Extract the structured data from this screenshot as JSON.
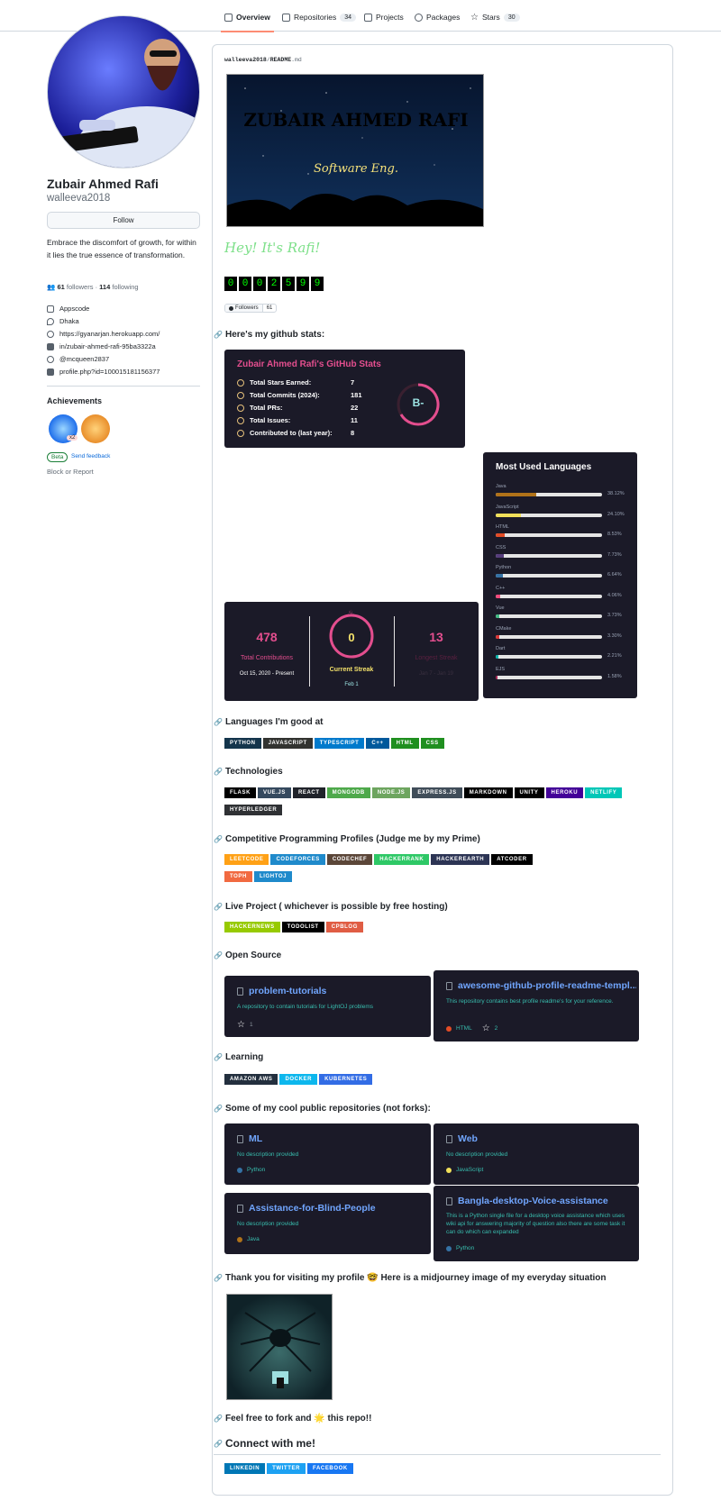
{
  "nav": {
    "tabs": [
      {
        "label": "Overview"
      },
      {
        "label": "Repositories",
        "count": "34"
      },
      {
        "label": "Projects"
      },
      {
        "label": "Packages"
      },
      {
        "label": "Stars",
        "count": "30"
      }
    ]
  },
  "profile": {
    "name": "Zubair Ahmed Rafi",
    "login": "walleeva2018",
    "follow_label": "Follow",
    "bio": "Embrace the discomfort of growth, for within it lies the true essence of transformation.",
    "followers": "61",
    "followers_label": "followers",
    "sep": "·",
    "following": "114",
    "following_label": "following",
    "company": "Appscode",
    "location": "Dhaka",
    "website": "https://gyanarjan.herokuapp.com/",
    "linkedin": "in/zubair-ahmed-rafi-95ba3322a",
    "twitter": "@mcqueen2837",
    "facebook": "profile.php?id=100015181156377",
    "achievements_title": "Achievements",
    "ach_count": "x2",
    "beta": "Beta",
    "feedback": "Send feedback",
    "block": "Block or Report"
  },
  "readme": {
    "path_user": "walleeva2018",
    "path_sep": "/",
    "path_file": "README",
    "path_ext": ".md",
    "banner_title": "ZUBAIR AHMED RAFI",
    "banner_sub": "Software Eng.",
    "greeting": "Hey! It's Rafi!",
    "counter": [
      "0",
      "0",
      "0",
      "2",
      "5",
      "9",
      "9"
    ],
    "followers_badge_label": "Followers",
    "followers_badge_count": "61",
    "h_stats": "Here's my github stats:",
    "stats_card": {
      "title": "Zubair Ahmed Rafi's GitHub Stats",
      "grade": "B-",
      "rows": [
        {
          "label": "Total Stars Earned:",
          "value": "7"
        },
        {
          "label": "Total Commits (2024):",
          "value": "181"
        },
        {
          "label": "Total PRs:",
          "value": "22"
        },
        {
          "label": "Total Issues:",
          "value": "11"
        },
        {
          "label": "Contributed to (last year):",
          "value": "8"
        }
      ]
    },
    "langs_card": {
      "title": "Most Used Languages",
      "langs": [
        {
          "name": "Java",
          "pct": "38.12%",
          "value": 38.12,
          "color": "#b07219"
        },
        {
          "name": "JavaScript",
          "pct": "24.10%",
          "value": 24.1,
          "color": "#f1e05a"
        },
        {
          "name": "HTML",
          "pct": "8.53%",
          "value": 8.53,
          "color": "#e34c26"
        },
        {
          "name": "CSS",
          "pct": "7.73%",
          "value": 7.73,
          "color": "#563d7c"
        },
        {
          "name": "Python",
          "pct": "6.64%",
          "value": 6.64,
          "color": "#3572A5"
        },
        {
          "name": "C++",
          "pct": "4.06%",
          "value": 4.06,
          "color": "#f34b7d"
        },
        {
          "name": "Vue",
          "pct": "3.73%",
          "value": 3.73,
          "color": "#41b883"
        },
        {
          "name": "CMake",
          "pct": "3.30%",
          "value": 3.3,
          "color": "#DA3434"
        },
        {
          "name": "Dart",
          "pct": "2.21%",
          "value": 2.21,
          "color": "#00B4AB"
        },
        {
          "name": "EJS",
          "pct": "1.58%",
          "value": 1.58,
          "color": "#a91e50"
        }
      ]
    },
    "streak": {
      "total": "478",
      "total_label": "Total Contributions",
      "total_range": "Oct 15, 2020 - Present",
      "current": "0",
      "current_label": "Current Streak",
      "current_date": "Feb 1",
      "longest": "13",
      "longest_label": "Longest Streak",
      "longest_range": "Jan 7 - Jan 19"
    },
    "h_langs": "Languages I'm good at",
    "langs": [
      {
        "label": "PYTHON",
        "color": "#14354c"
      },
      {
        "label": "JAVASCRIPT",
        "color": "#323330"
      },
      {
        "label": "TYPESCRIPT",
        "color": "#007acc"
      },
      {
        "label": "C++",
        "color": "#00599c"
      },
      {
        "label": "HTML",
        "color": "#1f8f1f"
      },
      {
        "label": "CSS",
        "color": "#1f8f1f"
      }
    ],
    "h_tech": "Technologies",
    "tech": [
      {
        "label": "FLASK",
        "color": "#000000"
      },
      {
        "label": "VUE.JS",
        "color": "#35495e"
      },
      {
        "label": "REACT",
        "color": "#20232a"
      },
      {
        "label": "MONGODB",
        "color": "#4ea94b"
      },
      {
        "label": "NODE.JS",
        "color": "#6da55f"
      },
      {
        "label": "EXPRESS.JS",
        "color": "#404d59"
      },
      {
        "label": "MARKDOWN",
        "color": "#000000"
      },
      {
        "label": "UNITY",
        "color": "#000000"
      },
      {
        "label": "HEROKU",
        "color": "#430098"
      },
      {
        "label": "NETLIFY",
        "color": "#00c7b7"
      },
      {
        "label": "HYPERLEDGER",
        "color": "#2f3134"
      }
    ],
    "h_cp": "Competitive Programming Profiles (Judge me by my Prime)",
    "cp": [
      {
        "label": "LEETCODE",
        "color": "#ffa116"
      },
      {
        "label": "CODEFORCES",
        "color": "#1f8acb"
      },
      {
        "label": "CODECHEF",
        "color": "#5b4638"
      },
      {
        "label": "HACKERRANK",
        "color": "#2ec866"
      },
      {
        "label": "HACKEREARTH",
        "color": "#2c3454"
      },
      {
        "label": "ATCODER",
        "color": "#000000"
      },
      {
        "label": "TOPH",
        "color": "#f16a41"
      },
      {
        "label": "LIGHTOJ",
        "color": "#1f8acb"
      }
    ],
    "h_live": "Live Project ( whichever is possible by free hosting)",
    "live": [
      {
        "label": "HACKERNEWS",
        "color": "#97ca00"
      },
      {
        "label": "TODOLIST",
        "color": "#000000"
      },
      {
        "label": "CPBLOG",
        "color": "#e05d44"
      }
    ],
    "h_os": "Open Source",
    "os": [
      {
        "title": "problem-tutorials",
        "desc": "A repository to contain tutorials for LightOJ problems",
        "stars": "1"
      },
      {
        "title": "awesome-github-profile-readme-templ...",
        "desc": "This repository contains best profile readme's for your reference.",
        "lang": "HTML",
        "lang_color": "#e34c26",
        "stars": "2"
      }
    ],
    "h_learning": "Learning",
    "learning": [
      {
        "label": "AMAZON AWS",
        "color": "#232f3e"
      },
      {
        "label": "DOCKER",
        "color": "#0db7ed"
      },
      {
        "label": "KUBERNETES",
        "color": "#326ce5"
      }
    ],
    "h_repos": "Some of my cool public repositories (not forks):",
    "repos": [
      {
        "title": "ML",
        "desc": "No description provided",
        "lang": "Python",
        "lang_color": "#3572A5"
      },
      {
        "title": "Web",
        "desc": "No description provided",
        "lang": "JavaScript",
        "lang_color": "#f1e05a"
      },
      {
        "title": "Assistance-for-Blind-People",
        "desc": "No description provided",
        "lang": "Java",
        "lang_color": "#b07219"
      },
      {
        "title": "Bangla-desktop-Voice-assistance",
        "desc": "This is a Python single file for a desktop voice assistance which uses wiki api for answering majority of question also there are some task it can do which can expanded",
        "lang": "Python",
        "lang_color": "#3572A5"
      }
    ],
    "h_thanks": "Thank you for visiting my profile 🤓 Here is a midjourney image of my everyday situation",
    "h_fork": "Feel free to fork and 🌟 this repo!!",
    "h_connect": "Connect with me!",
    "connect": [
      {
        "label": "LINKEDIN",
        "color": "#0077b5"
      },
      {
        "label": "TWITTER",
        "color": "#1da1f2"
      },
      {
        "label": "FACEBOOK",
        "color": "#1877f2"
      }
    ]
  }
}
